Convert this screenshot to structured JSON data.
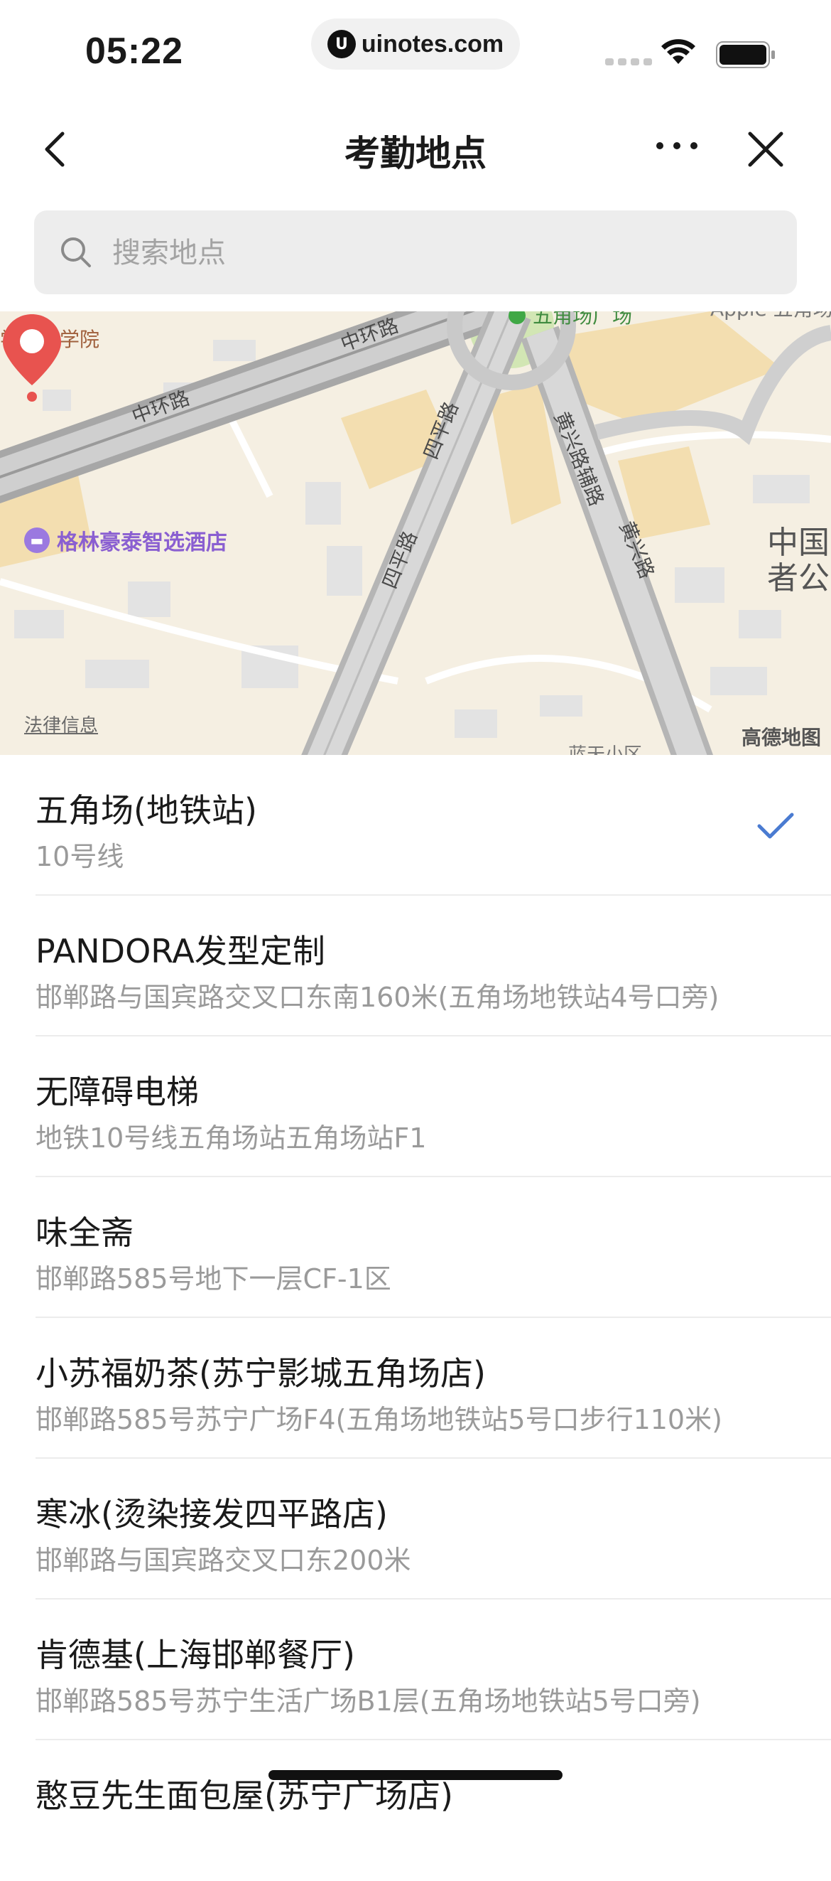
{
  "status_bar": {
    "time": "05:22",
    "url": "uinotes.com"
  },
  "header": {
    "title": "考勤地点"
  },
  "search": {
    "placeholder": "搜索地点",
    "value": ""
  },
  "map": {
    "labels": {
      "school": "学新闻学院",
      "hotel": "格林豪泰智选酒店",
      "road_zhonghuan_1": "中环路",
      "road_zhonghuan_2": "中环路",
      "road_siping": "四平路",
      "road_siping_2": "四平路",
      "road_huangxing_fu": "黄兴路辅路",
      "road_huangxing": "黄兴路",
      "poi_wujiaochang": "五角场广场",
      "poi_apple": "Apple 五角场",
      "poi_right": "中国",
      "poi_right_2": "者公",
      "poi_bottom": "蓝天小区",
      "legal": "法律信息",
      "amap": "高德地图"
    }
  },
  "locations": [
    {
      "name": "五角场(地铁站)",
      "address": "10号线",
      "selected": true
    },
    {
      "name": "PANDORA发型定制",
      "address": "邯郸路与国宾路交叉口东南160米(五角场地铁站4号口旁)",
      "selected": false
    },
    {
      "name": "无障碍电梯",
      "address": "地铁10号线五角场站五角场站F1",
      "selected": false
    },
    {
      "name": "味全斋",
      "address": "邯郸路585号地下一层CF-1区",
      "selected": false
    },
    {
      "name": "小苏福奶茶(苏宁影城五角场店)",
      "address": "邯郸路585号苏宁广场F4(五角场地铁站5号口步行110米)",
      "selected": false
    },
    {
      "name": "寒冰(烫染接发四平路店)",
      "address": "邯郸路与国宾路交叉口东200米",
      "selected": false
    },
    {
      "name": "肯德基(上海邯郸餐厅)",
      "address": "邯郸路585号苏宁生活广场B1层(五角场地铁站5号口旁)",
      "selected": false
    },
    {
      "name": "憨豆先生面包屋(苏宁广场店)",
      "address": "",
      "selected": false
    }
  ],
  "colors": {
    "accent": "#4a7bd1",
    "pin": "#e8534f"
  }
}
